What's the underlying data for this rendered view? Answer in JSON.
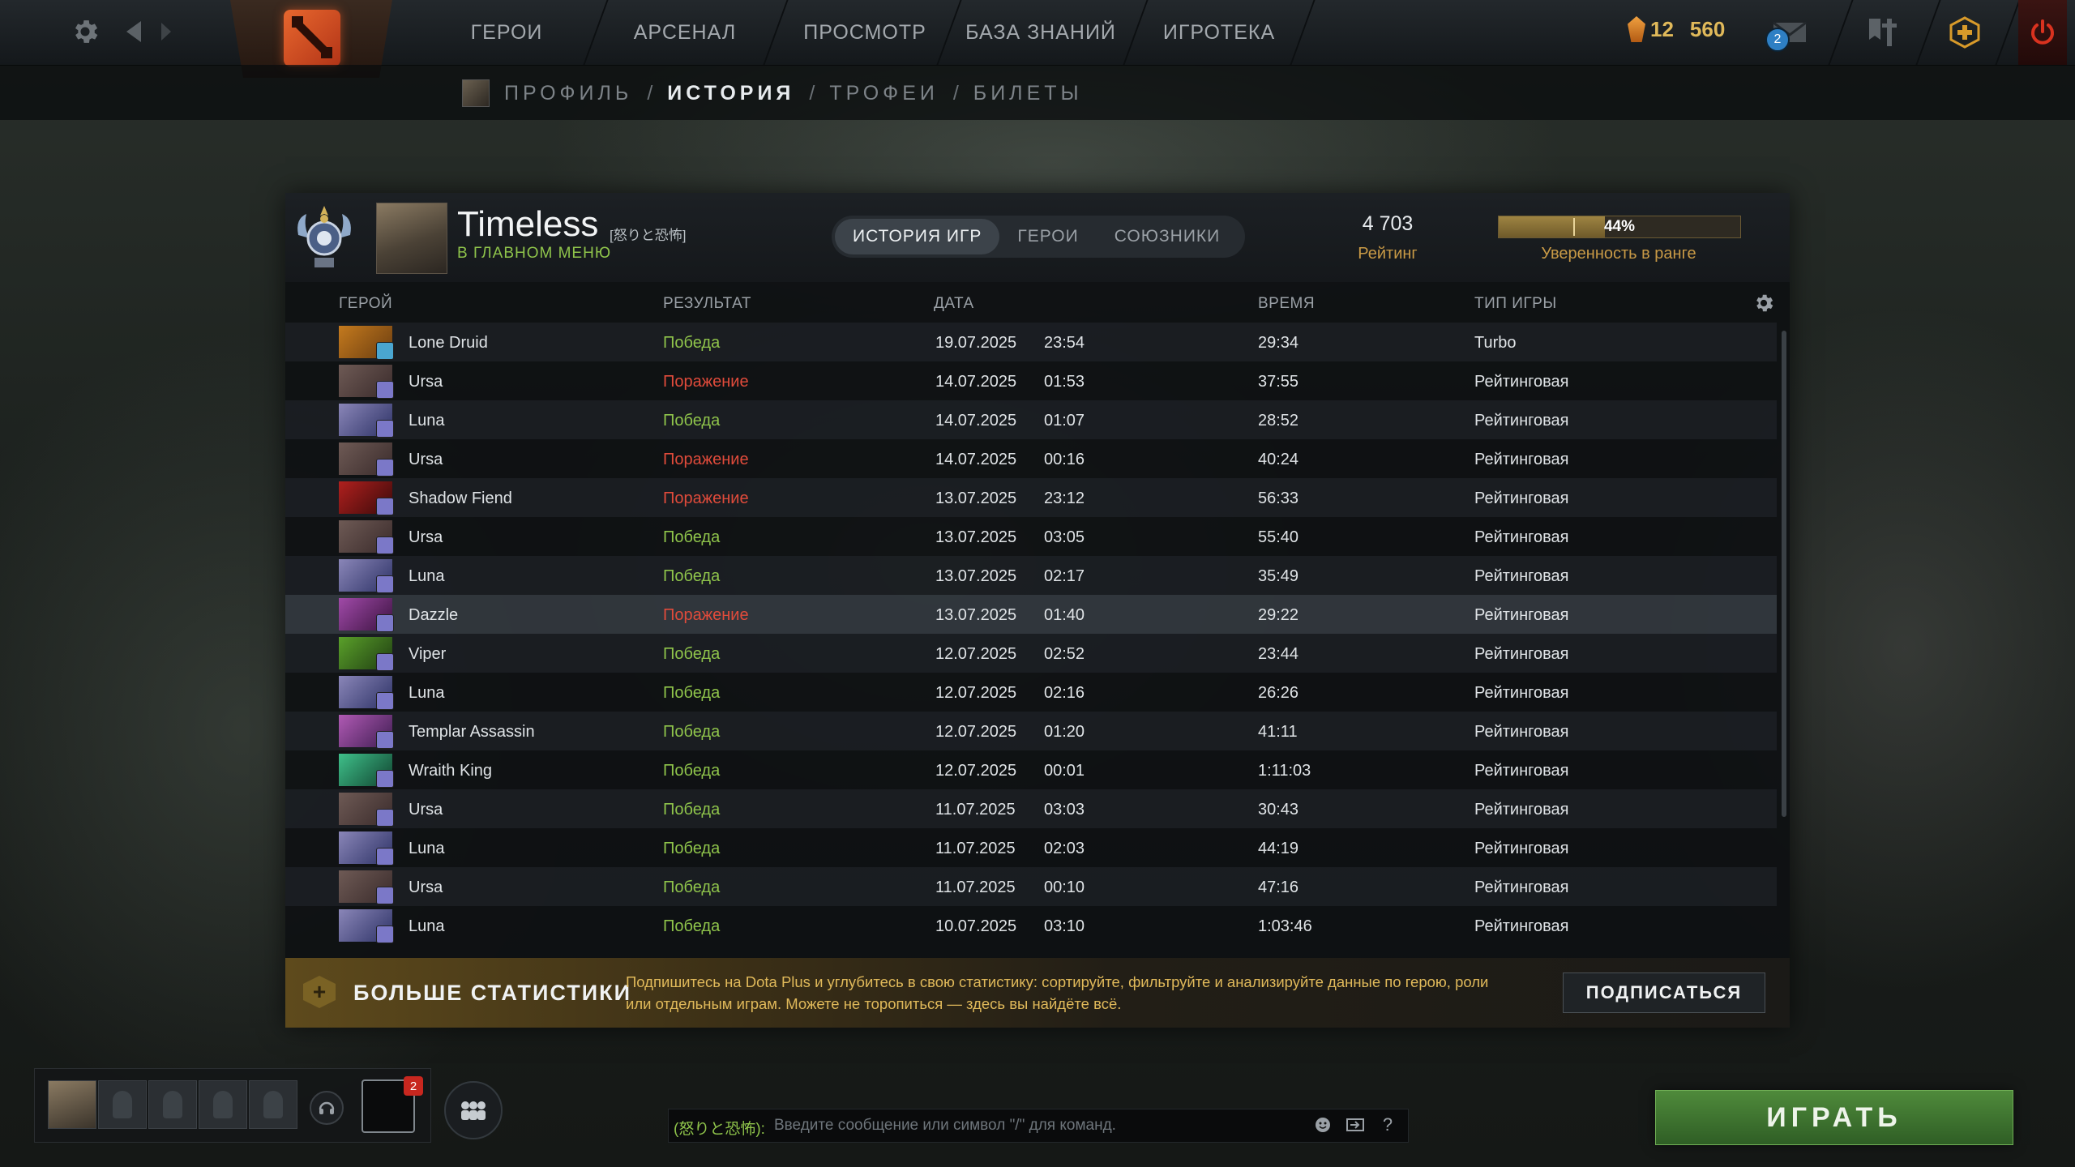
{
  "topbar": {
    "nav": [
      "ГЕРОИ",
      "АРСЕНАЛ",
      "ПРОСМОТР",
      "БАЗА ЗНАНИЙ",
      "ИГРОТЕКА"
    ],
    "shards_level": "12",
    "shards": "560",
    "mail_count": "2"
  },
  "subnav": {
    "items": [
      "ПРОФИЛЬ",
      "ИСТОРИЯ",
      "ТРОФЕИ",
      "БИЛЕТЫ"
    ],
    "separator": "/",
    "active": "ИСТОРИЯ"
  },
  "profile": {
    "name": "Timeless",
    "tag": "[怒りと恐怖]",
    "status": "В ГЛАВНОМ МЕНЮ",
    "tabs": [
      "ИСТОРИЯ ИГР",
      "ГЕРОИ",
      "СОЮЗНИКИ"
    ],
    "rating": "4 703",
    "rating_label": "Рейтинг",
    "confidence": "44%",
    "confidence_value": 0.44,
    "confidence_label": "Уверенность в ранге"
  },
  "columns": {
    "hero": "ГЕРОЙ",
    "result": "РЕЗУЛЬТАТ",
    "date": "ДАТА",
    "duration": "ВРЕМЯ",
    "mode": "ТИП ИГРЫ"
  },
  "matches": [
    {
      "hero": "Lone Druid",
      "result": "Победа",
      "date": "19.07.2025",
      "time": "23:54",
      "duration": "29:34",
      "mode": "Turbo"
    },
    {
      "hero": "Ursa",
      "result": "Поражение",
      "date": "14.07.2025",
      "time": "01:53",
      "duration": "37:55",
      "mode": "Рейтинговая"
    },
    {
      "hero": "Luna",
      "result": "Победа",
      "date": "14.07.2025",
      "time": "01:07",
      "duration": "28:52",
      "mode": "Рейтинговая"
    },
    {
      "hero": "Ursa",
      "result": "Поражение",
      "date": "14.07.2025",
      "time": "00:16",
      "duration": "40:24",
      "mode": "Рейтинговая"
    },
    {
      "hero": "Shadow Fiend",
      "result": "Поражение",
      "date": "13.07.2025",
      "time": "23:12",
      "duration": "56:33",
      "mode": "Рейтинговая"
    },
    {
      "hero": "Ursa",
      "result": "Победа",
      "date": "13.07.2025",
      "time": "03:05",
      "duration": "55:40",
      "mode": "Рейтинговая"
    },
    {
      "hero": "Luna",
      "result": "Победа",
      "date": "13.07.2025",
      "time": "02:17",
      "duration": "35:49",
      "mode": "Рейтинговая"
    },
    {
      "hero": "Dazzle",
      "result": "Поражение",
      "date": "13.07.2025",
      "time": "01:40",
      "duration": "29:22",
      "mode": "Рейтинговая"
    },
    {
      "hero": "Viper",
      "result": "Победа",
      "date": "12.07.2025",
      "time": "02:52",
      "duration": "23:44",
      "mode": "Рейтинговая"
    },
    {
      "hero": "Luna",
      "result": "Победа",
      "date": "12.07.2025",
      "time": "02:16",
      "duration": "26:26",
      "mode": "Рейтинговая"
    },
    {
      "hero": "Templar Assassin",
      "result": "Победа",
      "date": "12.07.2025",
      "time": "01:20",
      "duration": "41:11",
      "mode": "Рейтинговая"
    },
    {
      "hero": "Wraith King",
      "result": "Победа",
      "date": "12.07.2025",
      "time": "00:01",
      "duration": "1:11:03",
      "mode": "Рейтинговая"
    },
    {
      "hero": "Ursa",
      "result": "Победа",
      "date": "11.07.2025",
      "time": "03:03",
      "duration": "30:43",
      "mode": "Рейтинговая"
    },
    {
      "hero": "Luna",
      "result": "Победа",
      "date": "11.07.2025",
      "time": "02:03",
      "duration": "44:19",
      "mode": "Рейтинговая"
    },
    {
      "hero": "Ursa",
      "result": "Победа",
      "date": "11.07.2025",
      "time": "00:10",
      "duration": "47:16",
      "mode": "Рейтинговая"
    },
    {
      "hero": "Luna",
      "result": "Победа",
      "date": "10.07.2025",
      "time": "03:10",
      "duration": "1:03:46",
      "mode": "Рейтинговая"
    }
  ],
  "hero_colors": {
    "Lone Druid": [
      "#c47a1e",
      "#6b3d10"
    ],
    "Ursa": [
      "#6e5a55",
      "#3a2b2b"
    ],
    "Luna": [
      "#8a86b8",
      "#2d3266"
    ],
    "Shadow Fiend": [
      "#b0201e",
      "#3a0a0a"
    ],
    "Dazzle": [
      "#a04aa8",
      "#3b1240"
    ],
    "Viper": [
      "#5aa02a",
      "#1f3d12"
    ],
    "Templar Assassin": [
      "#b05ab4",
      "#3f1d52"
    ],
    "Wraith King": [
      "#3fc08a",
      "#10432f"
    ]
  },
  "role_colors": {
    "Turbo": "#4aa6d0",
    "Рейтинговая": "#7b78c8"
  },
  "result_win": "Победа",
  "promo": {
    "title": "БОЛЬШЕ СТАТИСТИКИ",
    "text": "Подпишитесь на Dota Plus и углубитесь в свою статистику: сортируйте, фильтруйте и анализируйте данные по герою, роли или отдельным играм. Можете не торопиться — здесь вы найдёте всё.",
    "button": "ПОДПИСАТЬСЯ"
  },
  "bottom": {
    "inbox_count": "2",
    "chat_channel": "(怒りと恐怖):",
    "chat_placeholder": "Введите сообщение или символ \"/\" для команд.",
    "help": "?",
    "play": "ИГРАТЬ"
  }
}
